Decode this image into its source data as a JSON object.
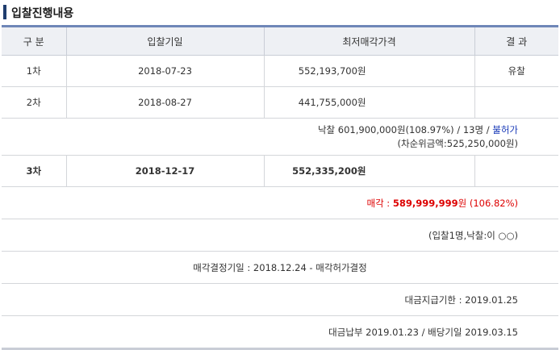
{
  "section_title": "입찰진행내용",
  "headers": {
    "round": "구 분",
    "date": "입찰기일",
    "min_price": "최저매각가격",
    "result": "결 과"
  },
  "rounds": [
    {
      "round": "1차",
      "date": "2018-07-23",
      "min_price": "552,193,700원",
      "result": "유찰"
    },
    {
      "round": "2차",
      "date": "2018-08-27",
      "min_price": "441,755,000원",
      "result": ""
    }
  ],
  "award": {
    "text": "낙찰 601,900,000원(108.97%) / 13명 / ",
    "permit_label": "불허가",
    "second_bid": "(차순위금액:525,250,000원)"
  },
  "round3": {
    "round": "3차",
    "date": "2018-12-17",
    "min_price": "552,335,200원",
    "result": ""
  },
  "sale": {
    "label": "매각 : ",
    "amount": "589,999,999",
    "unit": "원",
    "rate": "(106.82%)"
  },
  "bidders": "(입찰1명,낙찰:이 ○○)",
  "decision": "매각결정기일 : 2018.12.24 - 매각허가결정",
  "payment_deadline": "대금지급기한 : 2019.01.25",
  "payment_dividend": "대금납부 2019.01.23 / 배당기일 2019.03.15",
  "colors": {
    "accent": "#1f3d6e",
    "header_bg": "#eef0f4",
    "sale_red": "#dd0000",
    "link_blue": "#1a3bb8"
  }
}
